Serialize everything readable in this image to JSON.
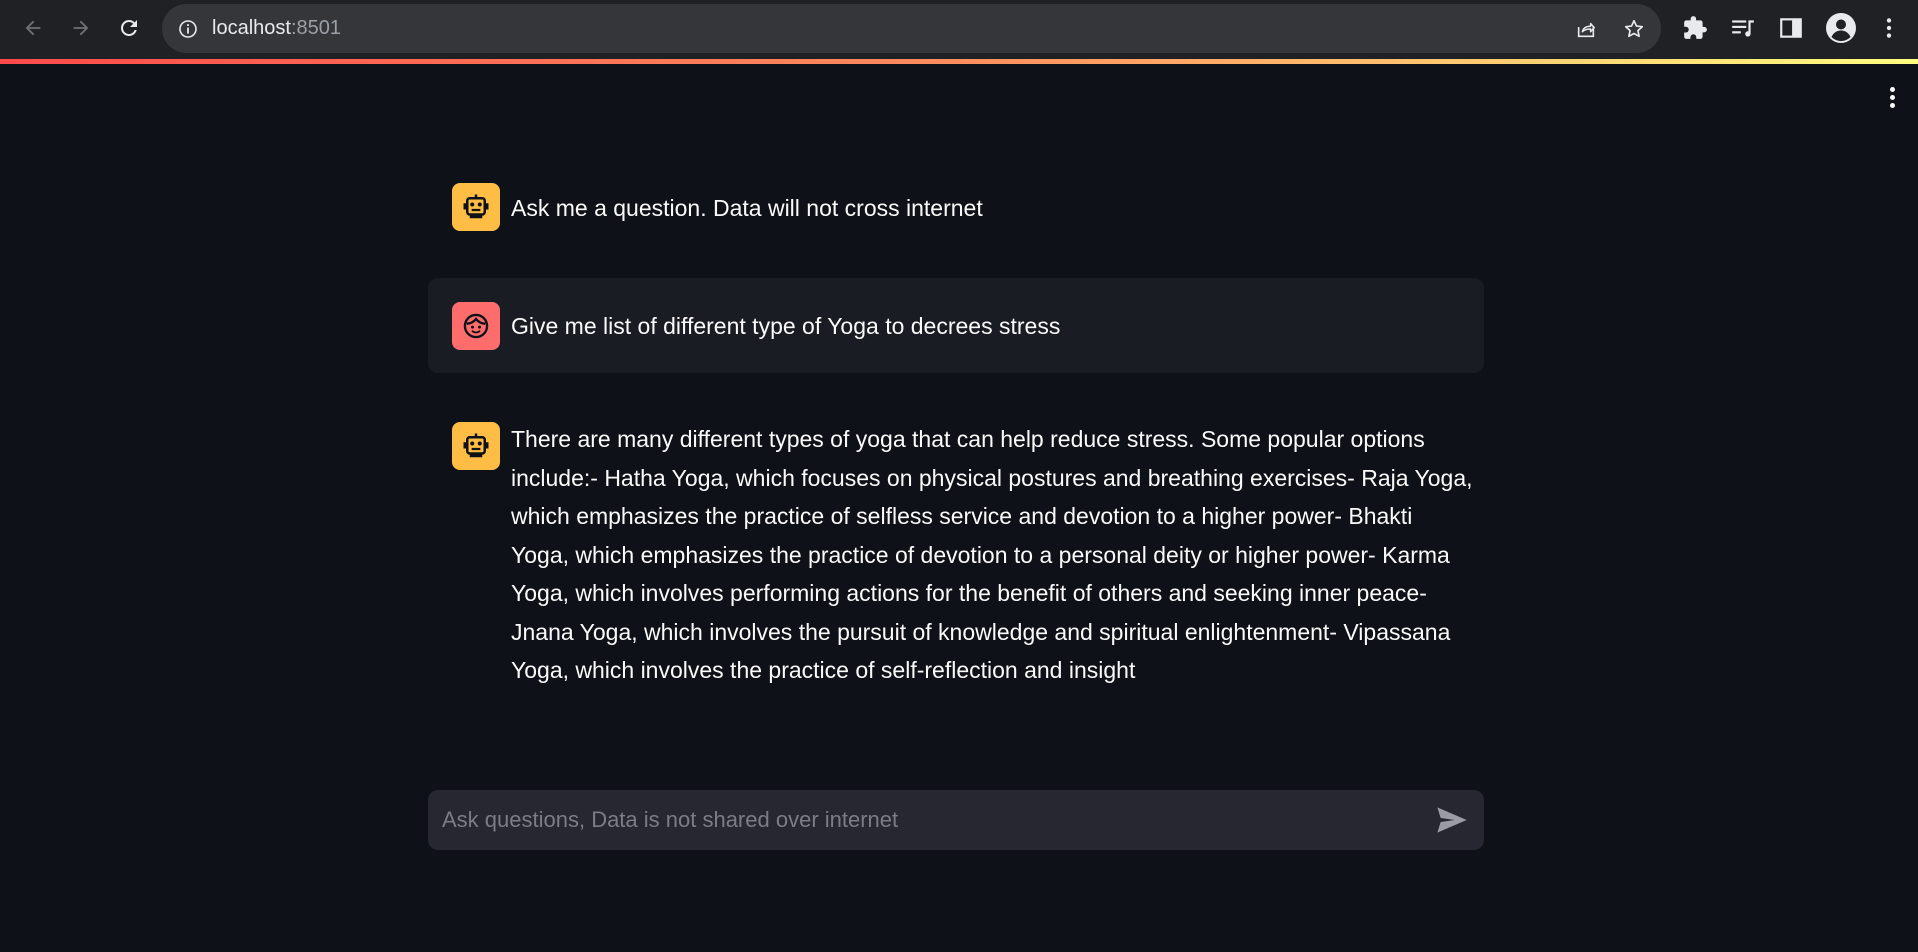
{
  "browser": {
    "url_host": "localhost",
    "url_port": ":8501"
  },
  "chat": {
    "messages": [
      {
        "role": "assistant",
        "avatar": "robot-icon",
        "text": "Ask me a question. Data will not cross internet"
      },
      {
        "role": "user",
        "avatar": "face-icon",
        "text": "Give me list of different type of Yoga to decrees stress"
      },
      {
        "role": "assistant",
        "avatar": "robot-icon",
        "text": "There are many different types of yoga that can help reduce stress. Some popular options include:- Hatha Yoga, which focuses on physical postures and breathing exercises- Raja Yoga, which emphasizes the practice of selfless service and devotion to a higher power- Bhakti Yoga, which emphasizes the practice of devotion to a personal deity or higher power- Karma Yoga, which involves performing actions for the benefit of others and seeking inner peace- Jnana Yoga, which involves the pursuit of knowledge and spiritual enlightenment- Vipassana Yoga, which involves the practice of self-reflection and insight"
      }
    ],
    "input": {
      "placeholder": "Ask questions, Data is not shared over internet",
      "value": ""
    }
  },
  "colors": {
    "background": "#0e1117",
    "bot_avatar": "#ffbd45",
    "user_avatar": "#ff6c6c",
    "user_bubble": "#1a1c24",
    "input_bg": "#262730"
  }
}
